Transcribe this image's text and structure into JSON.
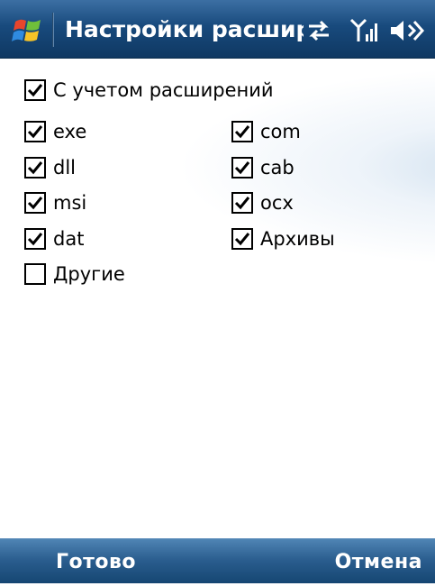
{
  "title_bar": {
    "title": "Настройки расширен",
    "icons": [
      "windows-start-icon",
      "sync-arrows-icon",
      "signal-strength-icon",
      "volume-icon"
    ]
  },
  "settings": {
    "with_extensions": {
      "label": "С учетом расширений",
      "checked": true
    },
    "extensions": [
      {
        "label": "exe",
        "checked": true
      },
      {
        "label": "dll",
        "checked": true
      },
      {
        "label": "msi",
        "checked": true
      },
      {
        "label": "dat",
        "checked": true
      },
      {
        "label": "Другие",
        "checked": false
      },
      {
        "label": "com",
        "checked": true
      },
      {
        "label": "cab",
        "checked": true
      },
      {
        "label": "ocx",
        "checked": true
      },
      {
        "label": "Архивы",
        "checked": true
      }
    ]
  },
  "softkeys": {
    "left": "Готово",
    "right": "Отмена"
  },
  "colors": {
    "title_bar": "#184a7d",
    "softkey_bar": "#2a5d8e",
    "text": "#000000",
    "background": "#ffffff"
  }
}
